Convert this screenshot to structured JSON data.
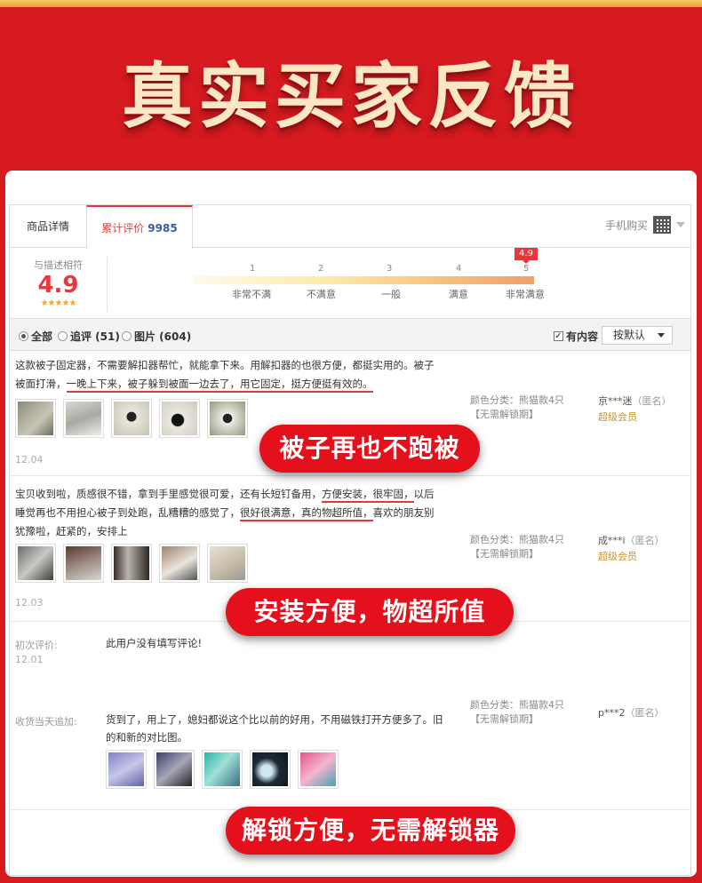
{
  "banner": {
    "title": "真实买家反馈"
  },
  "tabs": {
    "detail": "商品详情",
    "reviews_label": "累计评价",
    "reviews_count": "9985",
    "mobile_buy": "手机购买"
  },
  "rating": {
    "caption": "与描述相符",
    "score": "4.9",
    "stars": "★★★★★",
    "score_tag": "4.9",
    "scale_numbers": [
      "1",
      "2",
      "3",
      "4",
      "5"
    ],
    "scale_labels": [
      "非常不满",
      "不满意",
      "一般",
      "满意",
      "非常满意"
    ]
  },
  "filters": {
    "all": "全部",
    "followup": "追评 (51)",
    "images": "图片 (604)",
    "has_content": "有内容",
    "sort": "按默认"
  },
  "reviews": [
    {
      "text_a": "这款被子固定器，不需要解扣器帮忙，就能拿下来。用解扣器的也很方便，都挺实用的。被子被面打滑，",
      "text_b": "一晚上下来，被子躲到被面一边去了，用它固定，挺方便挺有效的。",
      "date": "12.04",
      "meta_color": "颜色分类：熊猫款4只",
      "meta_lock": "【无需解锁期】",
      "user": "京***迷",
      "anon": "（匿名）",
      "level": "超级会员"
    },
    {
      "text_a": "宝贝收到啦，质感很不错，拿到手里感觉很可爱，还有长短钉备用，",
      "text_b": "方便安装，很牢固，",
      "text_c": "以后睡觉再也不用担心被子到处跑，乱糟糟的感觉了，",
      "text_d": "很好很满意，真的物超所值，",
      "text_e": "喜欢的朋友别犹豫啦，赶紧的，安排上",
      "date": "12.03",
      "meta_color": "颜色分类：熊猫款4只",
      "meta_lock": "【无需解锁期】",
      "user": "成***i",
      "anon": "（匿名）",
      "level": "超级会员"
    },
    {
      "initial_label": "初次评价:",
      "initial_text": "此用户没有填写评论!",
      "date": "12.01",
      "followup_label": "收货当天追加:",
      "followup_text": "货到了，用上了，媳妇都说这个比以前的好用，不用磁铁打开方便多了。旧的和新的对比图。",
      "meta_color": "颜色分类：熊猫款4只",
      "meta_lock": "【无需解锁期】",
      "user": "p***2",
      "anon": "（匿名）"
    }
  ],
  "callouts": [
    "被子再也不跑被",
    "安装方便，物超所值",
    "解锁方便，无需解锁器"
  ],
  "colors": {
    "accent": "#e4393c",
    "banner_bg": "#d61a1f",
    "callout": "#e4111c"
  }
}
